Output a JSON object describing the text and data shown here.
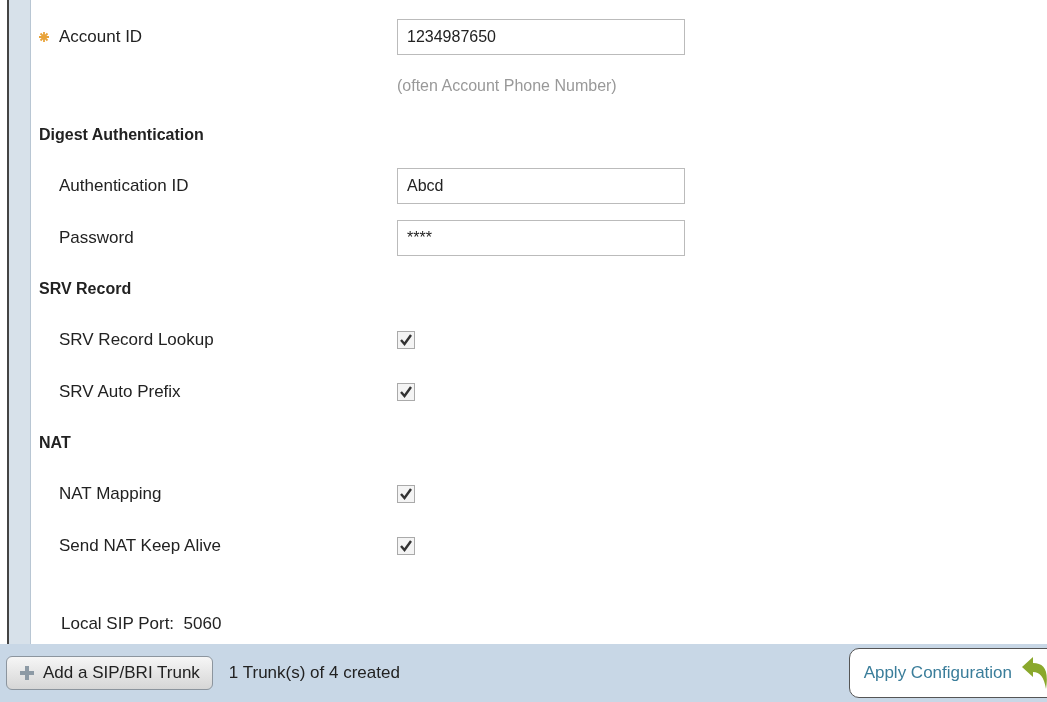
{
  "account": {
    "label": "Account ID",
    "required": true,
    "value": "1234987650",
    "hint": "(often Account Phone Number)"
  },
  "sections": [
    {
      "title": "Digest Authentication",
      "rows": [
        {
          "kind": "text",
          "label": "Authentication ID",
          "value": "Abcd"
        },
        {
          "kind": "text",
          "label": "Password",
          "value": "****"
        }
      ]
    },
    {
      "title": "SRV Record",
      "rows": [
        {
          "kind": "checkbox",
          "label": "SRV Record Lookup",
          "checked": true
        },
        {
          "kind": "checkbox",
          "label": "SRV Auto Prefix",
          "checked": true
        }
      ]
    },
    {
      "title": "NAT",
      "rows": [
        {
          "kind": "checkbox",
          "label": "NAT Mapping",
          "checked": true
        },
        {
          "kind": "checkbox",
          "label": "Send NAT Keep Alive",
          "checked": true
        }
      ]
    }
  ],
  "local_port": "Local SIP Port:  5060",
  "footer": {
    "add_button": "Add a SIP/BRI Trunk",
    "status": "1 Trunk(s) of 4 created",
    "apply_button": "Apply Configuration"
  }
}
